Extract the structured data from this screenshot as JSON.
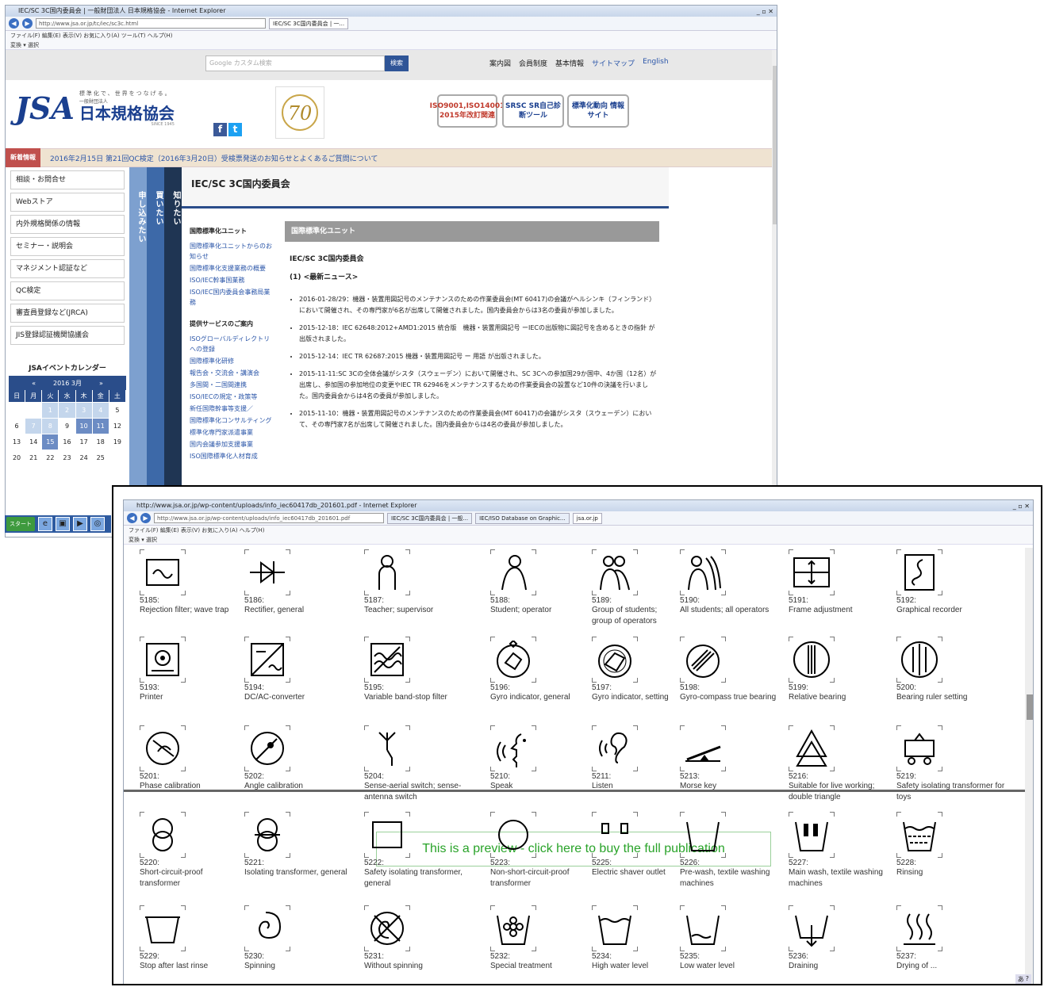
{
  "win1": {
    "title": "IEC/SC 3C国内委員会 | 一般財団法人 日本規格協会 - Internet Explorer",
    "url": "http://www.jsa.or.jp/tc/iec/sc3c.html",
    "tab": "IEC/SC 3C国内委員会 | 一...",
    "menu": "ファイル(F) 編集(E) 表示(V) お気に入り(A) ツール(T) ヘルプ(H)",
    "fav": "変換 ▾ 選択",
    "search_placeholder": "Google カスタム検索",
    "search_btn": "検索",
    "toplinks": [
      "案内図",
      "会員制度",
      "基本情報",
      "サイトマップ",
      "English"
    ],
    "logo_mark": "JSA",
    "logo_tag": "標準化で、世界をつなげる。",
    "logo_sub": "一般財団法人",
    "logo_name": "日本規格協会",
    "logo_since": "SINCE 1945",
    "anniv": "70",
    "banners": [
      "ISO9001,ISO14001 2015年改訂関連",
      "SRSC SR自己診断ツール",
      "標準化動向 情報サイト"
    ],
    "news_label": "新着情報",
    "news_text": "2016年2月15日 第21回QC検定（2016年3月20日）受検票発送のお知らせとよくあるご質問について",
    "left_buttons": [
      "相談・お問合せ",
      "Webストア",
      "内外規格関係の情報",
      "セミナー・説明会",
      "マネジメント認証など",
      "QC検定",
      "審査員登録など(JRCA)",
      "JIS登録認証機関協議会"
    ],
    "cal_title": "JSAイベントカレンダー",
    "cal_month": "2016 3月",
    "cal_days": [
      "日",
      "月",
      "火",
      "水",
      "木",
      "金",
      "土"
    ],
    "cal_rows": [
      [
        "",
        "",
        "1",
        "2",
        "3",
        "4",
        "5"
      ],
      [
        "6",
        "7",
        "8",
        "9",
        "10",
        "11",
        "12"
      ],
      [
        "13",
        "14",
        "15",
        "16",
        "17",
        "18",
        "19"
      ],
      [
        "20",
        "21",
        "22",
        "23",
        "24",
        "25",
        ""
      ]
    ],
    "vtabs": [
      "申し込みたい",
      "買いたい",
      "知りたい"
    ],
    "page_title": "IEC/SC 3C国内委員会",
    "nav_sec1": "国際標準化ユニット",
    "nav_items1": [
      "国際標準化ユニットからのお知らせ",
      "国際標準化支援業務の概要",
      "ISO/IEC幹事国業務",
      "ISO/IEC国内委員会事務局業務"
    ],
    "nav_sec2": "提供サービスのご案内",
    "nav_items2": [
      "ISOグローバルディレクトリへの登録",
      "国際標準化研修",
      "報告会・交流会・講演会",
      "多国間・二国間連携",
      "ISO/IECの規定・政策等",
      "新任国際幹事等支援／",
      "国際標準化コンサルティング",
      "標準化専門家派遣事業",
      "国内会議参加支援事業",
      "ISO国際標準化人材育成"
    ],
    "content_bar": "国際標準化ユニット",
    "content_h": "IEC/SC 3C国内委員会",
    "content_sub": "(1) <最新ニュース>",
    "news": [
      "2016-01-28/29：機器・装置用図記号のメンテナンスのための作業委員会(MT 60417)の会議がヘルシンキ（フィンランド）において開催され、その専門家が6名が出席して開催されました。国内委員会からは3名の委員が参加しました。",
      "2015-12-18：IEC 62648:2012+AMD1:2015 統合版　機器・装置用図記号 ーIECの出版物に図記号を含めるときの指針 が出版されました。",
      "2015-12-14：IEC TR 62687:2015 機器・装置用図記号 ー 用語 が出版されました。",
      "2015-11-11:SC 3Cの全体会議がシスタ（スウェーデン）において開催され、SC 3Cへの参加国29か国中、4か国（12名）が出席し、参加国の参加地位の変更やIEC TR 62946をメンテナンスするための作業委員会の設置など10件の決議を行いました。国内委員会からは4名の委員が参加しました。",
      "2015-11-10：機器・装置用図記号のメンテナンスのための作業委員会(MT 60417)の会議がシスタ（スウェーデン）において、その専門家7名が出席して開催されました。国内委員会からは4名の委員が参加しました。"
    ],
    "taskbar_start": "スタート"
  },
  "win2": {
    "title": "http://www.jsa.or.jp/wp-content/uploads/info_iec60417db_201601.pdf - Internet Explorer",
    "url": "http://www.jsa.or.jp/wp-content/uploads/info_iec60417db_201601.pdf",
    "tabs": [
      "IEC/SC 3C国内委員会 | 一般...",
      "IEC/ISO Database on Graphic...",
      "jsa.or.jp"
    ],
    "menu": "ファイル(F) 編集(E) 表示(V) お気に入り(A) ヘルプ(H)",
    "fav": "変換 ▾ 選択",
    "preview": "This is a preview - click here to buy the full publication",
    "rows": [
      [
        {
          "n": "5185:",
          "t": "Rejection filter; wave trap",
          "i": "filter-box-icon"
        },
        {
          "n": "5186:",
          "t": "Rectifier, general",
          "i": "rectifier-icon"
        },
        {
          "n": "5187:",
          "t": "Teacher; supervisor",
          "i": "person-icon"
        },
        {
          "n": "5188:",
          "t": "Student; operator",
          "i": "student-icon"
        },
        {
          "n": "5189:",
          "t": "Group of students; group of operators",
          "i": "group-icon"
        },
        {
          "n": "5190:",
          "t": "All students; all operators",
          "i": "all-students-icon"
        },
        {
          "n": "5191:",
          "t": "Frame adjustment",
          "i": "frame-adjust-icon"
        },
        {
          "n": "5192:",
          "t": "Graphical recorder",
          "i": "recorder-icon"
        }
      ],
      [
        {
          "n": "5193:",
          "t": "Printer",
          "i": "printer-icon"
        },
        {
          "n": "5194:",
          "t": "DC/AC-converter",
          "i": "converter-icon"
        },
        {
          "n": "5195:",
          "t": "Variable band-stop filter",
          "i": "bandstop-icon"
        },
        {
          "n": "5196:",
          "t": "Gyro indicator, general",
          "i": "gyro-icon"
        },
        {
          "n": "5197:",
          "t": "Gyro indicator, setting",
          "i": "gyro-setting-icon"
        },
        {
          "n": "5198:",
          "t": "Gyro-compass true bearing",
          "i": "gyro-compass-icon"
        },
        {
          "n": "5199:",
          "t": "Relative bearing",
          "i": "relative-bearing-icon"
        },
        {
          "n": "5200:",
          "t": "Bearing ruler setting",
          "i": "bearing-ruler-icon"
        }
      ],
      [
        {
          "n": "5201:",
          "t": "Phase calibration",
          "i": "phase-cal-icon"
        },
        {
          "n": "5202:",
          "t": "Angle calibration",
          "i": "angle-cal-icon"
        },
        {
          "n": "5204:",
          "t": "Sense-aerial switch; sense-antenna switch",
          "i": "antenna-icon"
        },
        {
          "n": "5210:",
          "t": "Speak",
          "i": "speak-icon"
        },
        {
          "n": "5211:",
          "t": "Listen",
          "i": "listen-icon"
        },
        {
          "n": "5213:",
          "t": "Morse key",
          "i": "morse-key-icon"
        },
        {
          "n": "5216:",
          "t": "Suitable for live working; double triangle",
          "i": "double-triangle-icon"
        },
        {
          "n": "5219:",
          "t": "Safety isolating transformer for toys",
          "i": "toy-transformer-icon"
        }
      ],
      [
        {
          "n": "5220:",
          "t": "Short-circuit-proof transformer",
          "i": "transformer-sc-icon"
        },
        {
          "n": "5221:",
          "t": "Isolating transformer, general",
          "i": "isolating-transformer-icon"
        },
        {
          "n": "5222:",
          "t": "Safety isolating transformer, general",
          "i": "safety-transformer-icon"
        },
        {
          "n": "5223:",
          "t": "Non-short-circuit-proof transformer",
          "i": "nonsc-transformer-icon"
        },
        {
          "n": "5225:",
          "t": "Electric shaver outlet",
          "i": "shaver-outlet-icon"
        },
        {
          "n": "5226:",
          "t": "Pre-wash, textile washing machines",
          "i": "prewash-icon"
        },
        {
          "n": "5227:",
          "t": "Main wash, textile washing machines",
          "i": "mainwash-icon"
        },
        {
          "n": "5228:",
          "t": "Rinsing",
          "i": "rinsing-icon"
        }
      ],
      [
        {
          "n": "5229:",
          "t": "Stop after last rinse",
          "i": "stop-rinse-icon"
        },
        {
          "n": "5230:",
          "t": "Spinning",
          "i": "spinning-icon"
        },
        {
          "n": "5231:",
          "t": "Without spinning",
          "i": "no-spinning-icon"
        },
        {
          "n": "5232:",
          "t": "Special treatment",
          "i": "special-treatment-icon"
        },
        {
          "n": "5234:",
          "t": "High water level",
          "i": "high-water-icon"
        },
        {
          "n": "5235:",
          "t": "Low water level",
          "i": "low-water-icon"
        },
        {
          "n": "5236:",
          "t": "Draining",
          "i": "draining-icon"
        },
        {
          "n": "5237:",
          "t": "Drying of ...",
          "i": "drying-icon"
        }
      ]
    ]
  }
}
